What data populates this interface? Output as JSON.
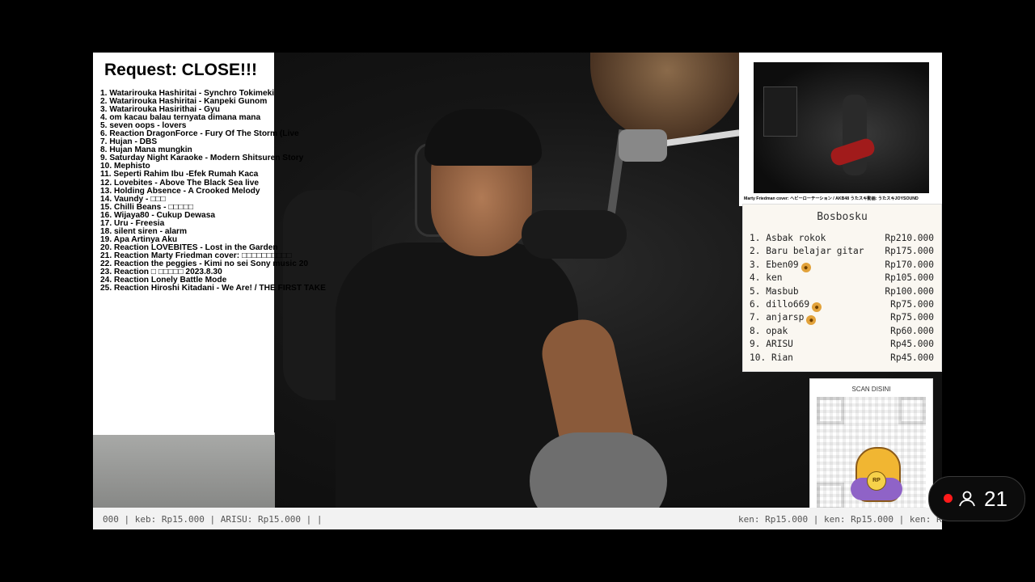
{
  "request_panel": {
    "title": "Request: CLOSE!!!",
    "items": [
      "1. Watarirouka Hashiritai - Synchro Tokimeki",
      "2. Watarirouka Hashiritai - Kanpeki Gunom",
      "3. Watarirouka Hasirithai - Gyu",
      "4. om kacau balau ternyata dimana mana",
      "5. seven oops - lovers",
      "6. Reaction  DragonForce - Fury Of The Storm (Live",
      "7. Hujan - DBS",
      "8. Hujan Mana mungkin",
      "9. Saturday Night Karaoke - Modern Shitsuren Story",
      "10. Mephisto",
      "11. Seperti Rahim Ibu -Efek Rumah Kaca",
      "12. Lovebites - Above The Black Sea live",
      "13. Holding Absence - A Crooked Melody",
      "14. Vaundy - □□□",
      "15. Chilli Beans - □□□□□",
      "16. Wijaya80 - Cukup Dewasa",
      "17. Uru - Freesia",
      "18. silent siren - alarm",
      "19. Apa Artinya Aku",
      "20. Reaction LOVEBITES - Lost in the Garden",
      "21. Reaction Marty Friedman cover: □□□□□□□□□□",
      "22. Reaction the peggies - Kimi no sei Sony music 20",
      "23. Reaction □ □□□□□ 2023.8.30",
      "24. Reaction Lonely Battle Mode",
      "25. Reaction Hiroshi Kitadani - We Are! / THE FIRST TAKE"
    ]
  },
  "video_panel": {
    "caption": "Marty Friedman cover: ヘビーローテーション / AKB48 うたスキ動画: うたスキJOYSOUND"
  },
  "leaderboard": {
    "title": "Bosbosku",
    "entries": [
      {
        "rank": "1.",
        "name": "Asbak rokok",
        "amount": "Rp210.000",
        "badge": false
      },
      {
        "rank": "2.",
        "name": "Baru belajar gitar",
        "amount": "Rp175.000",
        "badge": false
      },
      {
        "rank": "3.",
        "name": "Eben09",
        "amount": "Rp170.000",
        "badge": true
      },
      {
        "rank": "4.",
        "name": "ken",
        "amount": "Rp105.000",
        "badge": false
      },
      {
        "rank": "5.",
        "name": "Masbub",
        "amount": "Rp100.000",
        "badge": false
      },
      {
        "rank": "6.",
        "name": "dillo669",
        "amount": "Rp75.000",
        "badge": true
      },
      {
        "rank": "7.",
        "name": "anjarsp",
        "amount": "Rp75.000",
        "badge": true
      },
      {
        "rank": "8.",
        "name": "opak",
        "amount": "Rp60.000",
        "badge": false
      },
      {
        "rank": "9.",
        "name": "ARISU",
        "amount": "Rp45.000",
        "badge": false
      },
      {
        "rank": "10.",
        "name": "Rian",
        "amount": "Rp45.000",
        "badge": false
      }
    ]
  },
  "qr_panel": {
    "label": "SCAN DISINI",
    "coin_text": "RP"
  },
  "ticker": {
    "left_text": "000 | keb: Rp15.000 | ARISU: Rp15.000 |  |",
    "right_text": "ken: Rp15.000 | ken: Rp15.000 | ken: R"
  },
  "viewer": {
    "count": "21"
  },
  "colors": {
    "live_dot": "#ff1a1a",
    "badge": "#e2a23a",
    "mascot_cloak": "#8f63c7"
  }
}
